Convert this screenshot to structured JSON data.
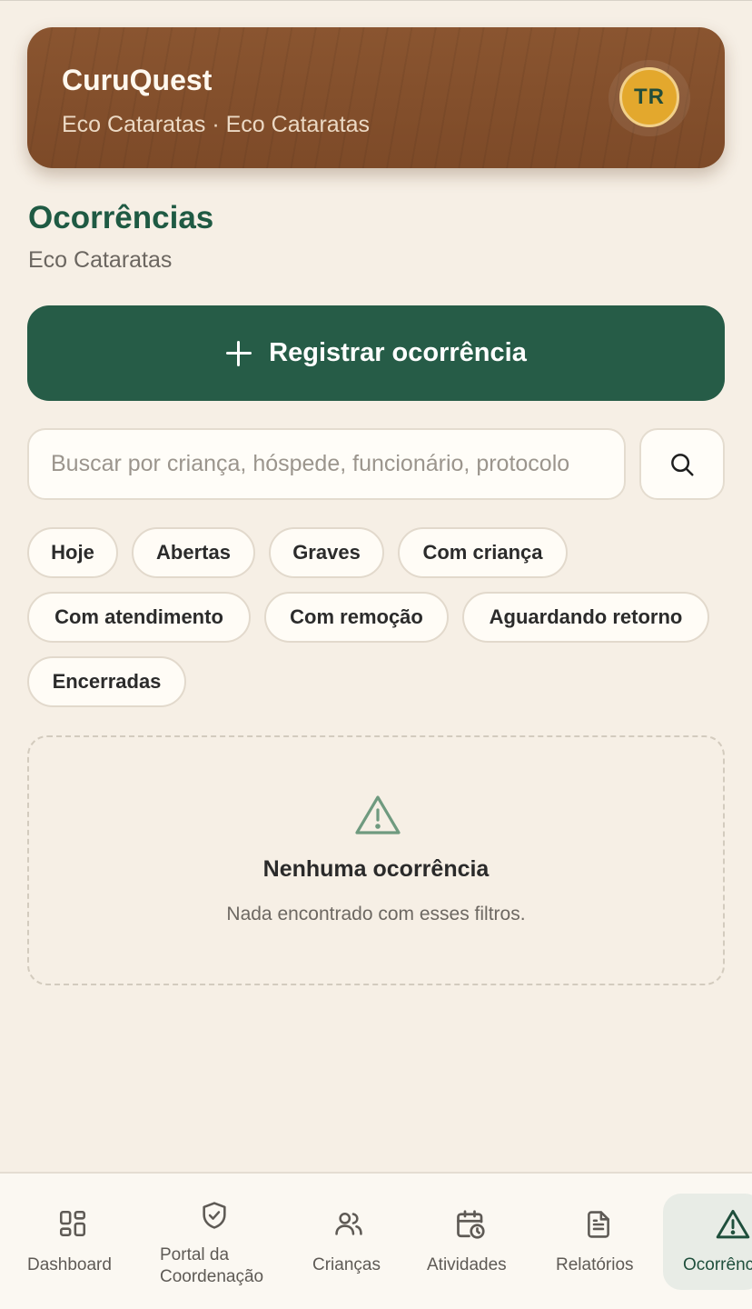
{
  "header": {
    "app_title": "CuruQuest",
    "subtitle": "Eco Cataratas · Eco Cataratas",
    "avatar_initials": "TR"
  },
  "page": {
    "title": "Ocorrências",
    "subtitle": "Eco Cataratas"
  },
  "actions": {
    "register_label": "Registrar ocorrência"
  },
  "search": {
    "placeholder": "Buscar por criança, hóspede, funcionário, protocolo",
    "value": ""
  },
  "filters": [
    "Hoje",
    "Abertas",
    "Graves",
    "Com criança",
    "Com atendimento",
    "Com remoção",
    "Aguardando retorno",
    "Encerradas"
  ],
  "empty_state": {
    "title": "Nenhuma ocorrência",
    "description": "Nada encontrado com esses filtros."
  },
  "bottom_nav": [
    {
      "label": "Dashboard",
      "icon": "dashboard-icon"
    },
    {
      "label": "Portal da Coordenação",
      "icon": "shield-check-icon"
    },
    {
      "label": "Crianças",
      "icon": "users-icon"
    },
    {
      "label": "Atividades",
      "icon": "calendar-clock-icon"
    },
    {
      "label": "Relatórios",
      "icon": "document-icon"
    },
    {
      "label": "Ocorrências",
      "icon": "warning-icon",
      "active": true
    }
  ],
  "colors": {
    "brand_green": "#265c47",
    "header_brown": "#7d4a28",
    "avatar_gold": "#e3a82d",
    "background": "#f6efe5"
  }
}
